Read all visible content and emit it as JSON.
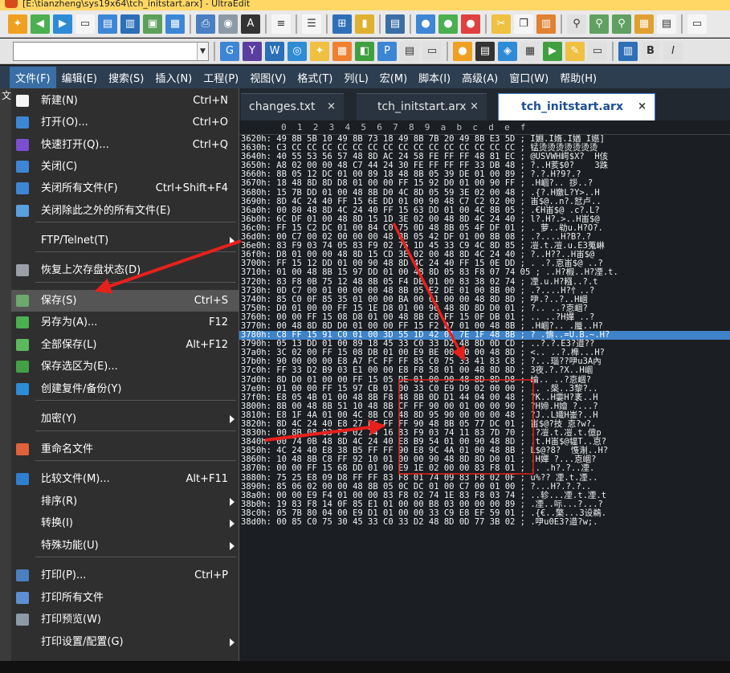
{
  "window": {
    "title": "[E:\\tianzheng\\sys19x64\\tch_initstart.arx] - UltraEdit"
  },
  "menubar": [
    {
      "label": "文件(F)",
      "name": "menu-file",
      "active": true
    },
    {
      "label": "编辑(E)",
      "name": "menu-edit"
    },
    {
      "label": "搜索(S)",
      "name": "menu-search"
    },
    {
      "label": "插入(N)",
      "name": "menu-insert"
    },
    {
      "label": "工程(P)",
      "name": "menu-project"
    },
    {
      "label": "视图(V)",
      "name": "menu-view"
    },
    {
      "label": "格式(T)",
      "name": "menu-format"
    },
    {
      "label": "列(L)",
      "name": "menu-column"
    },
    {
      "label": "宏(M)",
      "name": "menu-macro"
    },
    {
      "label": "脚本(I)",
      "name": "menu-script"
    },
    {
      "label": "高级(A)",
      "name": "menu-advanced"
    },
    {
      "label": "窗口(W)",
      "name": "menu-window"
    },
    {
      "label": "帮助(H)",
      "name": "menu-help"
    }
  ],
  "leftstrip": {
    "label": "文"
  },
  "tabs": [
    {
      "label": "changes.txt",
      "active": false
    },
    {
      "label": "tch_initstart.arx",
      "active": false
    },
    {
      "label": "tch_initstart.arx",
      "active": true
    }
  ],
  "tab_close": "×",
  "hexview": {
    "header": "0  1  2  3  4  5  6  7  8  9  a  b  c  d  e  f",
    "rows": [
      "3620h: 49 8B 5B 10 49 8B 73 18 49 8B 7B 20 49 8B E3 5D ; I婣.I媠.I媨 I嬨]",
      "3630h: C3 CC CC CC CC CC CC CC CC CC CC CC CC CC CC CC ; 锰烫烫烫烫烫烫烫",
      "3640h: 40 55 53 56 57 48 8D AC 24 58 FE FF FF 48 81 EC ; @USVWH崿$X?  H侅",
      "3650h: A8 02 00 00 48 C7 44 24 30 FE FF FF FF 33 DB 48 ; ?..H荄$0?    3跦",
      "3660h: 8B 05 12 DC 01 00 89 18 48 8B 05 39 DE 01 00 89 ; ?.?.H?9?.?",
      "3670h: 18 48 8D 8D D8 01 00 00 FF 15 92 D0 01 00 90 FF ; .H崓?.. 拶..?",
      "3680h: 15 7B DD 01 00 48 8B D0 4C 8D 05 59 3E 02 00 48 ; .{?.H嬓L?Y>..H",
      "3690h: 8D 4C 24 40 FF 15 6E DD 01 00 90 48 C7 C2 02 00 ; 峀$@..n?.恏卢..",
      "36a0h: 00 80 48 8D 4C 24 40 FF 15 63 DD 01 00 4C 8B 05 ; .€H峀$@ .c?.L?",
      "36b0h: 6C DF 01 00 48 8D 15 1D 3E 02 00 48 8D 4C 24 40 ; l?.H?.>..H峀$@",
      "36c0h: FF 15 C2 DC 01 00 84 C0 75 0D 48 8B 05 4F DF 01 ; . 萝..劺u.H?O?.",
      "36d0h: 00 C7 00 02 00 00 00 48 8B 05 42 DF 01 00 8B 08 ; .?....H?B?.?",
      "36e0h: 83 F9 03 74 05 83 F9 02 75 1D 45 33 C9 4C 8D 85 ; 凒.t.凒.u.E3蒐崊",
      "36f0h: D8 01 00 00 48 8D 15 CD 3E 02 00 48 8D 4C 24 40 ; ?..H??..H峀$@",
      "3700h: FF 15 12 DD 01 00 90 48 8D 4C 24 40 FF 15 0E DD ; . .?.怘峀$@ ..?",
      "3710h: 01 00 48 8B 15 97 DD 01 00 48 8D 05 83 F8 07 74 05 ; ..H?椵..H?凐.t.",
      "3720h: 83 F8 0B 75 12 48 8B 05 F4 DE 01 00 83 38 02 74 ; 凐.u.H?糨..?.t",
      "3730h: 0D C7 00 01 00 00 00 48 8B 05 E2 DE 01 00 8B 00 ; .?....H?忄..?",
      "3740h: 85 C0 0F 85 35 01 00 00 BA 00 01 00 00 48 8D 8D ; 吚.?..?..H崓",
      "3750h: D0 01 00 00 FF 15 1E D8 01 00 90 48 8D 8D D0 01 ; ?.. ..?怘崓?",
      "3760h: 00 00 FF 15 08 D8 01 00 48 8B C8 FF 15 0F DB 01 ; .. ..?H嬋 ..?",
      "3770h: 00 48 8D 8D D0 01 00 00 FF 15 F2 D7 01 00 48 8B ; .H崓?.. .蜃..H?",
      "3780h: C8 FF 15 91 C0 01 00 3D 55 1D 42 01 7E 1F 48 8B ; ? .懤..=U.B.~.H?",
      "3790h: 05 13 DD 01 00 89 18 45 33 C0 33 D2 48 8D 0D CD ; ..?.?.E3?逪??",
      "37a0h: 3C 02 00 FF 15 08 DB 01 00 E9 BE 00 00 00 48 8D ; <.. ..?.榫...H?",
      "37b0h: 90 00 00 00 E8 A7 FC FF FF 85 C0 75 33 41 83 C8 ; ?...瑙??吚u3A內",
      "37c0h: FF 33 D2 B9 03 E1 00 00 E8 F8 58 01 00 48 8D 8D ; 3夜.?.?X..H崓",
      "37d0h: 8D D0 01 00 00 FF 15 05 DE 01 00 90 48 8D 8D D8 ; 崘.. ..?怘崓?",
      "37e0h: 01 00 00 FF 15 97 CB 01 00 33 C0 E9 D9 02 00 00 ; .. .椝..3黎?..",
      "37f0h: E8 05 4B 01 00 48 8B F8 48 8B 0D D1 44 04 00 48 ; ?K..H孁H?袲..H",
      "3800h: 8B 00 48 8B 51 10 48 8B CF FF 90 00 01 00 00 90 ; ?H媂.H嬒 ?...?",
      "3810h: E8 1F 4A 01 00 4C 8B C0 48 8D 95 90 00 00 00 48 ; ?J..L嬂H崟?..H",
      "3820h: 8D 4C 24 40 E8 27 BC FF FF 90 48 8B 05 77 DC 01 ; 峀$@?技 怘?w?.",
      "3830h: 00 8B 08 83 F9 02 74 16 83 F9 03 74 11 83 7D 70 ; .?凒.t.凒.t.億p",
      "3840h: 00 74 0B 48 8D 4C 24 40 E8 B9 54 01 00 90 48 8D ; .t.H峀$@韫T..怘?",
      "3850h: 4C 24 40 E8 38 B5 FF FF 90 E8 9C 4A 01 00 48 8B ; L$@?8?  愯淛..H?",
      "3860h: 10 48 8B C8 FF 92 10 01 00 00 90 48 8D 8D D0 01 ; .H嬋 ?...怘崓?",
      "3870h: 00 00 FF 15 68 DD 01 00 E9 1E 02 00 00 83 F8 01 ; .. .h?.?..凐.",
      "3880h: 75 25 E8 09 D8 FF FF 83 F8 01 74 09 83 F8 02 0F ; u%?? 凐.t.凐..",
      "3890h: 85 06 02 00 00 48 8B 05 0C DC 01 00 C7 00 01 00 ; ?...H?.?.?..",
      "38a0h: 00 00 E9 F4 01 00 00 83 F8 02 74 1E 83 F8 03 74 ; ..轸...凐.t.凐.t",
      "38b0h: 19 83 F8 14 0F 85 E1 01 00 00 B8 03 00 00 00 89 ; .凐..呩...?...?",
      "38c0h: 05 7B 80 04 00 E9 D1 01 00 00 33 C9 E8 EF 59 01 ; .{€..檠...3设鵜.",
      "38d0h: 00 85 C0 75 30 45 33 C0 33 D2 48 8D 0D 77 3B 02 ; .吚u0E3?逪?w;."
    ]
  },
  "file_menu": [
    {
      "label": "新建(N)",
      "shortcut": "Ctrl+N",
      "icon": "new-file-icon",
      "color": "#f5f5f5"
    },
    {
      "label": "打开(O)...",
      "shortcut": "Ctrl+O",
      "icon": "open-folder-icon",
      "color": "#3d86d6"
    },
    {
      "label": "快速打开(Q)...",
      "shortcut": "Ctrl+Q",
      "icon": "quick-open-icon",
      "color": "#7a4fd0"
    },
    {
      "label": "关闭(C)",
      "shortcut": "",
      "icon": "close-file-icon",
      "color": "#3d86d6"
    },
    {
      "label": "关闭所有文件(F)",
      "shortcut": "Ctrl+Shift+F4",
      "icon": "close-all-icon",
      "color": "#3d86d6"
    },
    {
      "label": "关闭除此之外的所有文件(E)",
      "shortcut": "",
      "icon": "close-others-icon",
      "color": "#5aa0e0"
    },
    {
      "label": "FTP/Telnet(T)",
      "shortcut": "",
      "icon": "",
      "submenu": true
    },
    {
      "label": "恢复上次存盘状态(D)",
      "shortcut": "",
      "icon": "revert-icon",
      "color": "#9aa0a6"
    },
    {
      "label": "保存(S)",
      "shortcut": "Ctrl+S",
      "icon": "save-icon",
      "color": "#6da86d",
      "highlighted": true
    },
    {
      "label": "另存为(A)...",
      "shortcut": "F12",
      "icon": "save-as-icon",
      "color": "#4caf50"
    },
    {
      "label": "全部保存(L)",
      "shortcut": "Alt+F12",
      "icon": "save-all-icon",
      "color": "#5cb85c"
    },
    {
      "label": "保存选区为(E)...",
      "shortcut": "",
      "icon": "save-selection-icon",
      "color": "#43a047"
    },
    {
      "label": "创建复件/备份(Y)",
      "shortcut": "",
      "icon": "backup-icon",
      "color": "#2e8bd6"
    },
    {
      "label": "加密(Y)",
      "shortcut": "",
      "icon": "",
      "submenu": true
    },
    {
      "label": "重命名文件",
      "shortcut": "",
      "icon": "rename-icon",
      "color": "#e0623a"
    },
    {
      "label": "比较文件(M)...",
      "shortcut": "Alt+F11",
      "icon": "compare-icon",
      "color": "#2f7fd1"
    },
    {
      "label": "排序(R)",
      "shortcut": "",
      "icon": "",
      "submenu": true
    },
    {
      "label": "转换(I)",
      "shortcut": "",
      "icon": "",
      "submenu": true
    },
    {
      "label": "特殊功能(U)",
      "shortcut": "",
      "icon": "",
      "submenu": true
    },
    {
      "label": "打印(P)...",
      "shortcut": "Ctrl+P",
      "icon": "print-icon",
      "color": "#4a7fc1"
    },
    {
      "label": "打印所有文件",
      "shortcut": "",
      "icon": "print-all-icon",
      "color": "#5b8fd1"
    },
    {
      "label": "打印预览(W)",
      "shortcut": "",
      "icon": "print-preview-icon",
      "color": "#8c9aa8"
    },
    {
      "label": "打印设置/配置(G)",
      "shortcut": "",
      "icon": "",
      "submenu": true
    }
  ],
  "colors": {
    "menubar": "#2d3e50",
    "selection": "#3e82c8",
    "annotation_red": "#e8201c",
    "titlebar": "#ffd764"
  }
}
